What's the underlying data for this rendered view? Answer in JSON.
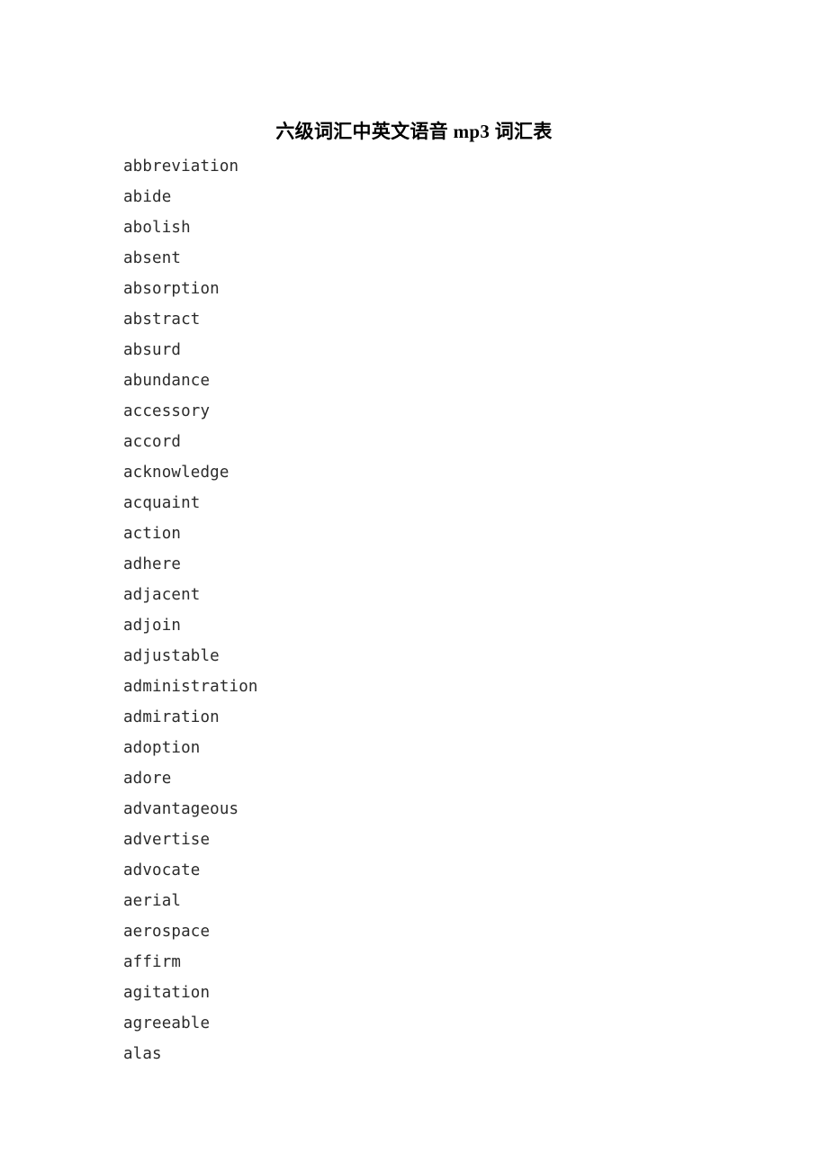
{
  "document": {
    "title": "六级词汇中英文语音 mp3 词汇表",
    "background_color": "#ffffff",
    "text_color": "#2b2b2b",
    "title_color": "#000000"
  },
  "word_list": {
    "count": 30,
    "items": [
      "abbreviation",
      "abide",
      "abolish",
      "absent",
      "absorption",
      "abstract",
      "absurd",
      "abundance",
      "accessory",
      "accord",
      "acknowledge",
      "acquaint",
      "action",
      "adhere",
      "adjacent",
      "adjoin",
      "adjustable",
      "administration",
      "admiration",
      "adoption",
      "adore",
      "advantageous",
      "advertise",
      "advocate",
      "aerial",
      "aerospace",
      "affirm",
      "agitation",
      "agreeable",
      "alas"
    ]
  }
}
